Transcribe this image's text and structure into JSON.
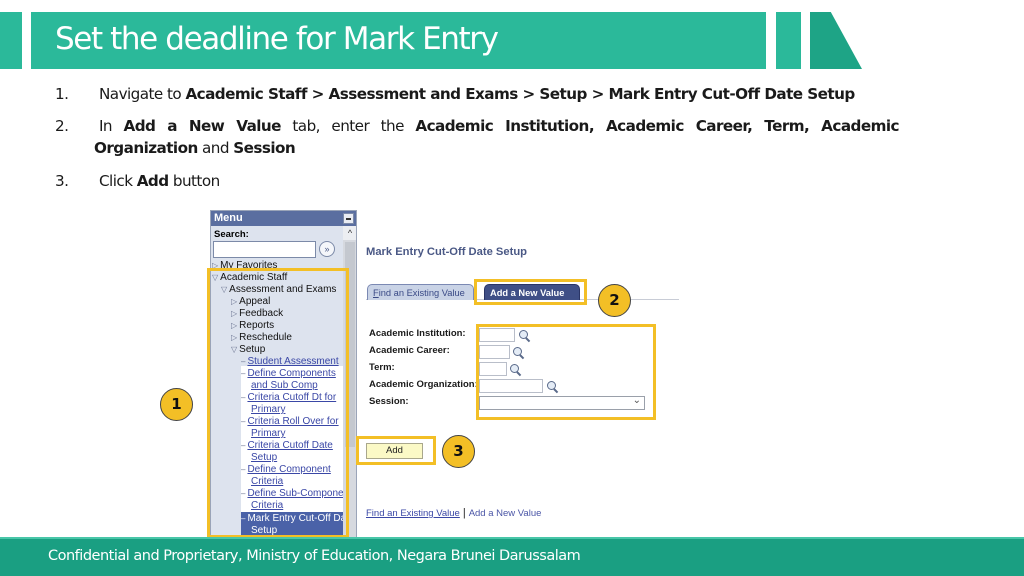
{
  "header": {
    "title": "Set the deadline for Mark Entry",
    "accent_color": "#2bb99a"
  },
  "steps": [
    {
      "number": "1.",
      "prefix": "Navigate to ",
      "path": "Academic Staff > Assessment and Exams > Setup > Mark Entry Cut-Off Date Setup"
    },
    {
      "number": "2.",
      "in": "In ",
      "tab_name": "Add a New Value",
      "mid": " tab, enter the ",
      "fields_line1": "Academic Institution, Academic Career, Term, Academic",
      "fields_line2a": "Organization",
      "and": " and ",
      "fields_line2b": "Session"
    },
    {
      "number": "3.",
      "prefix": "Click ",
      "button_name": "Add",
      "suffix": " button"
    }
  ],
  "menu": {
    "title": "Menu",
    "search_label": "Search:",
    "search_value": "",
    "go_icon": "»",
    "items": {
      "favorites": "My Favorites",
      "academic_staff": "Academic Staff",
      "assessment": "Assessment and Exams",
      "appeal": "Appeal",
      "feedback": "Feedback",
      "reports": "Reports",
      "reschedule": "Reschedule",
      "setup": "Setup"
    },
    "setup_links": [
      [
        "Student Assessment"
      ],
      [
        "Define Components",
        "and Sub Comp"
      ],
      [
        "Criteria Cutoff Dt for",
        "Primary"
      ],
      [
        "Criteria Roll Over for",
        "Primary"
      ],
      [
        "Criteria Cutoff Date",
        "Setup"
      ],
      [
        "Define Component",
        "Criteria"
      ],
      [
        "Define Sub-Compone",
        "Criteria"
      ]
    ],
    "selected": [
      "Mark Entry Cut-Off Da",
      "Setup"
    ]
  },
  "page": {
    "title": "Mark Entry Cut-Off Date Setup",
    "tabs": {
      "find_first": "F",
      "find_rest": "ind an Existing Value",
      "add": "Add a New Value"
    },
    "fields": {
      "institution": {
        "label": "Academic Institution:",
        "value": ""
      },
      "career": {
        "label": "Academic Career:",
        "value": ""
      },
      "term": {
        "label": "Term:",
        "value": ""
      },
      "organization": {
        "label": "Academic Organization:",
        "value": ""
      },
      "session": {
        "label": "Session:",
        "value": ""
      }
    },
    "add_button": "Add",
    "links": {
      "find": "Find an Existing Value",
      "separator": "|",
      "add": "Add a New Value"
    }
  },
  "badges": {
    "one": "1",
    "two": "2",
    "three": "3"
  },
  "footer": {
    "text": "Confidential and Proprietary, Ministry of Education, Negara Brunei Darussalam",
    "color": "#1a9f82"
  }
}
